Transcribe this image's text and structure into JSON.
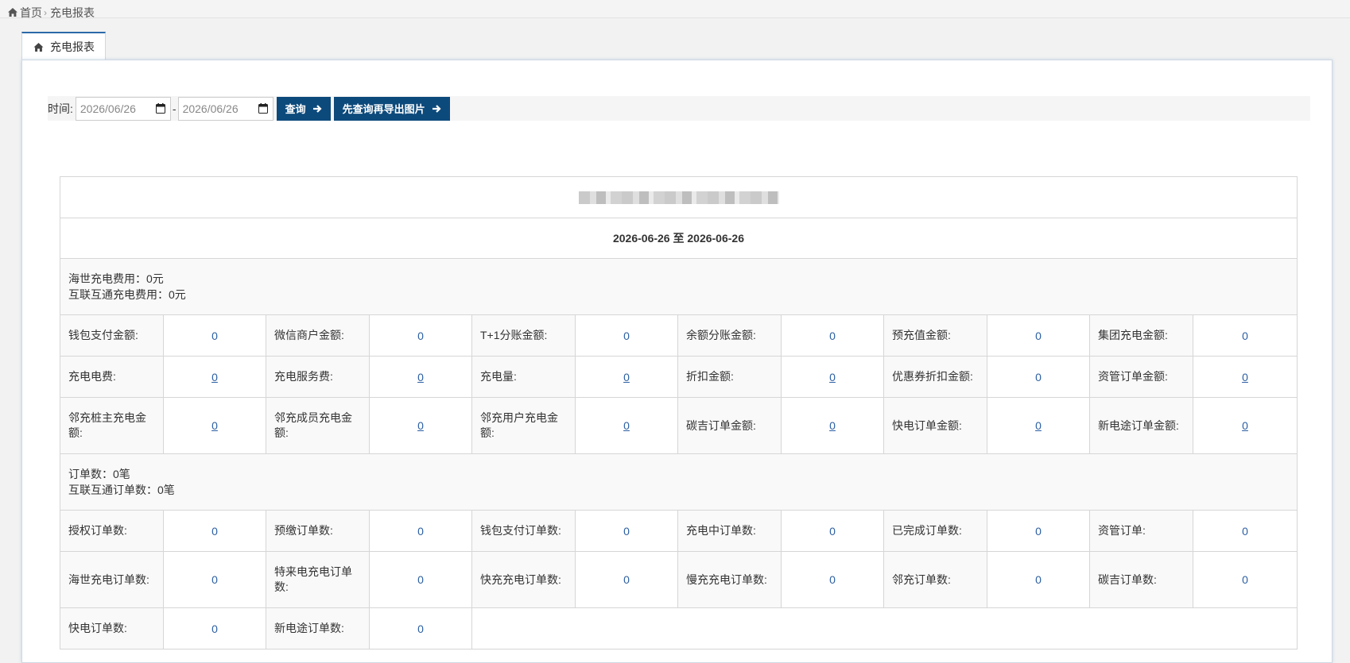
{
  "breadcrumb": {
    "home": "首页",
    "current": "充电报表"
  },
  "tab": {
    "label": "充电报表"
  },
  "toolbar": {
    "time_label": "时间:",
    "start_date": "2026/06/26",
    "dash": "-",
    "end_date": "2026/06/26",
    "query_button": "查询",
    "export_button": "先查询再导出图片"
  },
  "report": {
    "date_range": "2026-06-26 至 2026-06-26",
    "fee_summary": {
      "line1": "海世充电费用：0元",
      "line2": "互联互通充电费用：0元"
    },
    "fee_rows": [
      [
        {
          "label": "钱包支付金额:",
          "value": "0",
          "link": false
        },
        {
          "label": "微信商户金额:",
          "value": "0",
          "link": false
        },
        {
          "label": "T+1分账金额:",
          "value": "0",
          "link": false
        },
        {
          "label": "余额分账金额:",
          "value": "0",
          "link": false
        },
        {
          "label": "预充值金额:",
          "value": "0",
          "link": false
        },
        {
          "label": "集团充电金额:",
          "value": "0",
          "link": false
        }
      ],
      [
        {
          "label": "充电电费:",
          "value": "0",
          "link": true
        },
        {
          "label": "充电服务费:",
          "value": "0",
          "link": true
        },
        {
          "label": "充电量:",
          "value": "0",
          "link": true
        },
        {
          "label": "折扣金额:",
          "value": "0",
          "link": true
        },
        {
          "label": "优惠券折扣金额:",
          "value": "0",
          "link": false
        },
        {
          "label": "资管订单金额:",
          "value": "0",
          "link": true
        }
      ],
      [
        {
          "label": "邻充桩主充电金额:",
          "value": "0",
          "link": true
        },
        {
          "label": "邻充成员充电金额:",
          "value": "0",
          "link": true
        },
        {
          "label": "邻充用户充电金额:",
          "value": "0",
          "link": true
        },
        {
          "label": "碳吉订单金额:",
          "value": "0",
          "link": true
        },
        {
          "label": "快电订单金额:",
          "value": "0",
          "link": true
        },
        {
          "label": "新电途订单金额:",
          "value": "0",
          "link": true
        }
      ]
    ],
    "order_summary": {
      "line1": "订单数：0笔",
      "line2": "互联互通订单数：0笔"
    },
    "order_rows": [
      [
        {
          "label": "授权订单数:",
          "value": "0"
        },
        {
          "label": "预缴订单数:",
          "value": "0"
        },
        {
          "label": "钱包支付订单数:",
          "value": "0"
        },
        {
          "label": "充电中订单数:",
          "value": "0"
        },
        {
          "label": "已完成订单数:",
          "value": "0"
        },
        {
          "label": "资管订单:",
          "value": "0"
        }
      ],
      [
        {
          "label": "海世充电订单数:",
          "value": "0"
        },
        {
          "label": "特来电充电订单数:",
          "value": "0"
        },
        {
          "label": "快充充电订单数:",
          "value": "0"
        },
        {
          "label": "慢充充电订单数:",
          "value": "0"
        },
        {
          "label": "邻充订单数:",
          "value": "0"
        },
        {
          "label": "碳吉订单数:",
          "value": "0"
        }
      ],
      [
        {
          "label": "快电订单数:",
          "value": "0"
        },
        {
          "label": "新电途订单数:",
          "value": "0"
        }
      ]
    ]
  },
  "colors": {
    "primary_button": "#0d4a7c",
    "value_text": "#2b5fa3",
    "tab_accent": "#2b6aa8"
  }
}
